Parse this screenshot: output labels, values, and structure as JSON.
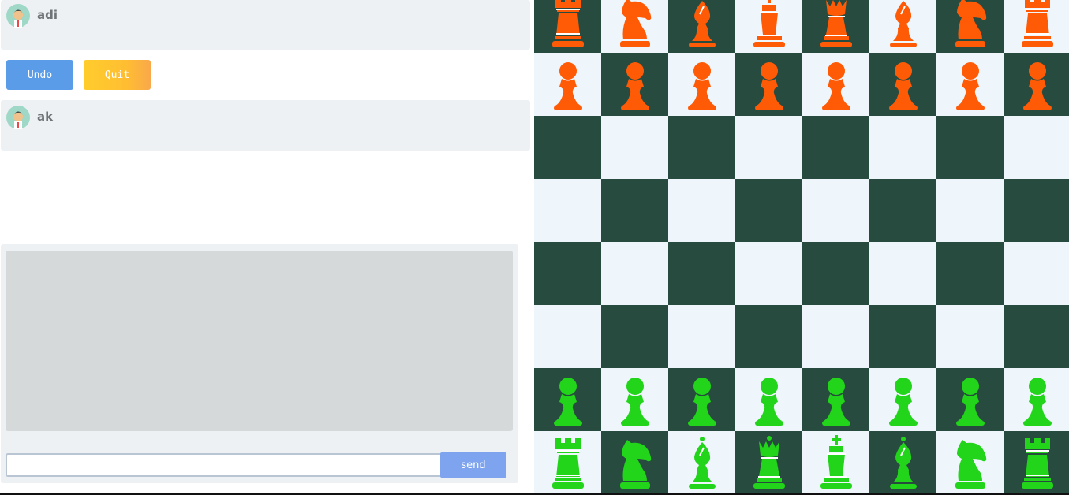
{
  "players": {
    "top": {
      "name": "adi"
    },
    "bottom": {
      "name": "ak"
    }
  },
  "controls": {
    "undo_label": "Undo",
    "quit_label": "Quit"
  },
  "chat": {
    "input_value": "",
    "send_label": "send"
  },
  "colors": {
    "top_side": "#ff5a05",
    "bottom_side": "#22d41a",
    "dark_square": "#274b3f",
    "light_square": "#eef5fb"
  },
  "board": {
    "ranks": [
      [
        "rook",
        "knight",
        "bishop",
        "king",
        "queen",
        "bishop",
        "knight",
        "rook"
      ],
      [
        "pawn",
        "pawn",
        "pawn",
        "pawn",
        "pawn",
        "pawn",
        "pawn",
        "pawn"
      ],
      [
        "",
        "",
        "",
        "",
        "",
        "",
        "",
        ""
      ],
      [
        "",
        "",
        "",
        "",
        "",
        "",
        "",
        ""
      ],
      [
        "",
        "",
        "",
        "",
        "",
        "",
        "",
        ""
      ],
      [
        "",
        "",
        "",
        "",
        "",
        "",
        "",
        ""
      ],
      [
        "pawn",
        "pawn",
        "pawn",
        "pawn",
        "pawn",
        "pawn",
        "pawn",
        "pawn"
      ],
      [
        "rook",
        "knight",
        "bishop",
        "queen",
        "king",
        "bishop",
        "knight",
        "rook"
      ]
    ],
    "piece_sides": [
      "top",
      "top",
      "",
      "",
      "",
      "",
      "bottom",
      "bottom"
    ]
  }
}
